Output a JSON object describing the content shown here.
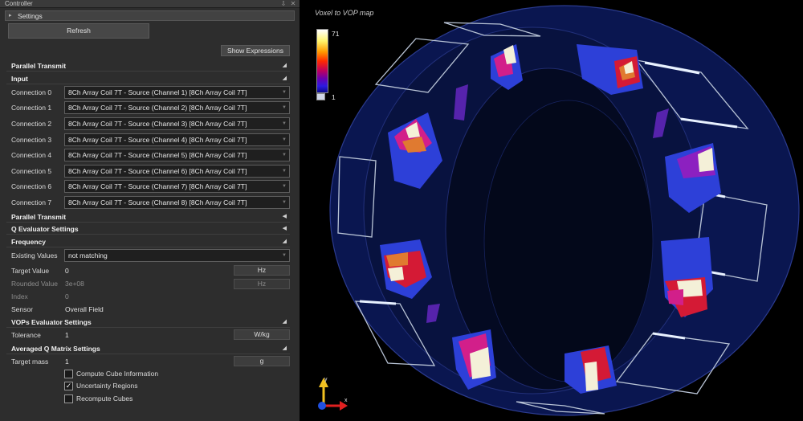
{
  "panel": {
    "title": "Controller",
    "tab_label": "Settings",
    "refresh_label": "Refresh",
    "show_expressions_label": "Show Expressions",
    "pin_glyph": "⇩",
    "close_glyph": "✕"
  },
  "sections": {
    "parallel_transmit_1": "Parallel Transmit",
    "input": "Input",
    "parallel_transmit_2": "Parallel Transmit",
    "q_evaluator": "Q Evaluator Settings",
    "frequency": "Frequency",
    "vops_evaluator": "VOPs Evaluator Settings",
    "averaged_q": "Averaged Q Matrix Settings"
  },
  "connections": [
    {
      "label": "Connection 0",
      "value": "8Ch Array Coil 7T - Source  (Channel 1) [8Ch Array Coil 7T]"
    },
    {
      "label": "Connection 1",
      "value": "8Ch Array Coil 7T - Source  (Channel 2) [8Ch Array Coil 7T]"
    },
    {
      "label": "Connection 2",
      "value": "8Ch Array Coil 7T - Source  (Channel 3) [8Ch Array Coil 7T]"
    },
    {
      "label": "Connection 3",
      "value": "8Ch Array Coil 7T - Source  (Channel 4) [8Ch Array Coil 7T]"
    },
    {
      "label": "Connection 4",
      "value": "8Ch Array Coil 7T - Source  (Channel 5) [8Ch Array Coil 7T]"
    },
    {
      "label": "Connection 5",
      "value": "8Ch Array Coil 7T - Source  (Channel 6) [8Ch Array Coil 7T]"
    },
    {
      "label": "Connection 6",
      "value": "8Ch Array Coil 7T - Source  (Channel 7) [8Ch Array Coil 7T]"
    },
    {
      "label": "Connection 7",
      "value": "8Ch Array Coil 7T - Source  (Channel 8) [8Ch Array Coil 7T]"
    }
  ],
  "frequency": {
    "existing_values_label": "Existing Values",
    "existing_values_value": "not matching",
    "target_value_label": "Target Value",
    "target_value": "0",
    "target_unit": "Hz",
    "rounded_value_label": "Rounded Value",
    "rounded_value": "3e+08",
    "rounded_unit": "Hz",
    "index_label": "Index",
    "index_value": "0",
    "sensor_label": "Sensor",
    "sensor_value": "Overall Field"
  },
  "vops": {
    "tolerance_label": "Tolerance",
    "tolerance_value": "1",
    "tolerance_unit": "W/kg"
  },
  "averaged_q": {
    "target_mass_label": "Target mass",
    "target_mass_value": "1",
    "target_mass_unit": "g",
    "compute_cube_label": "Compute Cube Information",
    "compute_cube_checked": false,
    "uncertainty_label": "Uncertainty Regions",
    "uncertainty_checked": true,
    "recompute_label": "Recompute Cubes",
    "recompute_checked": false
  },
  "viewport": {
    "title": "Voxel to VOP map",
    "legend_max": "71",
    "legend_min": "1",
    "axis_x": "x",
    "axis_y": "y",
    "colors": {
      "background": "#000000",
      "ring_fill": "#0a1650",
      "ring_stroke": "#2b3b8f",
      "hot_white": "#f4f0d8",
      "hot_pink": "#d21f8a",
      "hot_red": "#d41a35",
      "hot_orange": "#e07a30",
      "hot_blue": "#2d40d8",
      "hot_purple": "#8c20c0"
    }
  }
}
